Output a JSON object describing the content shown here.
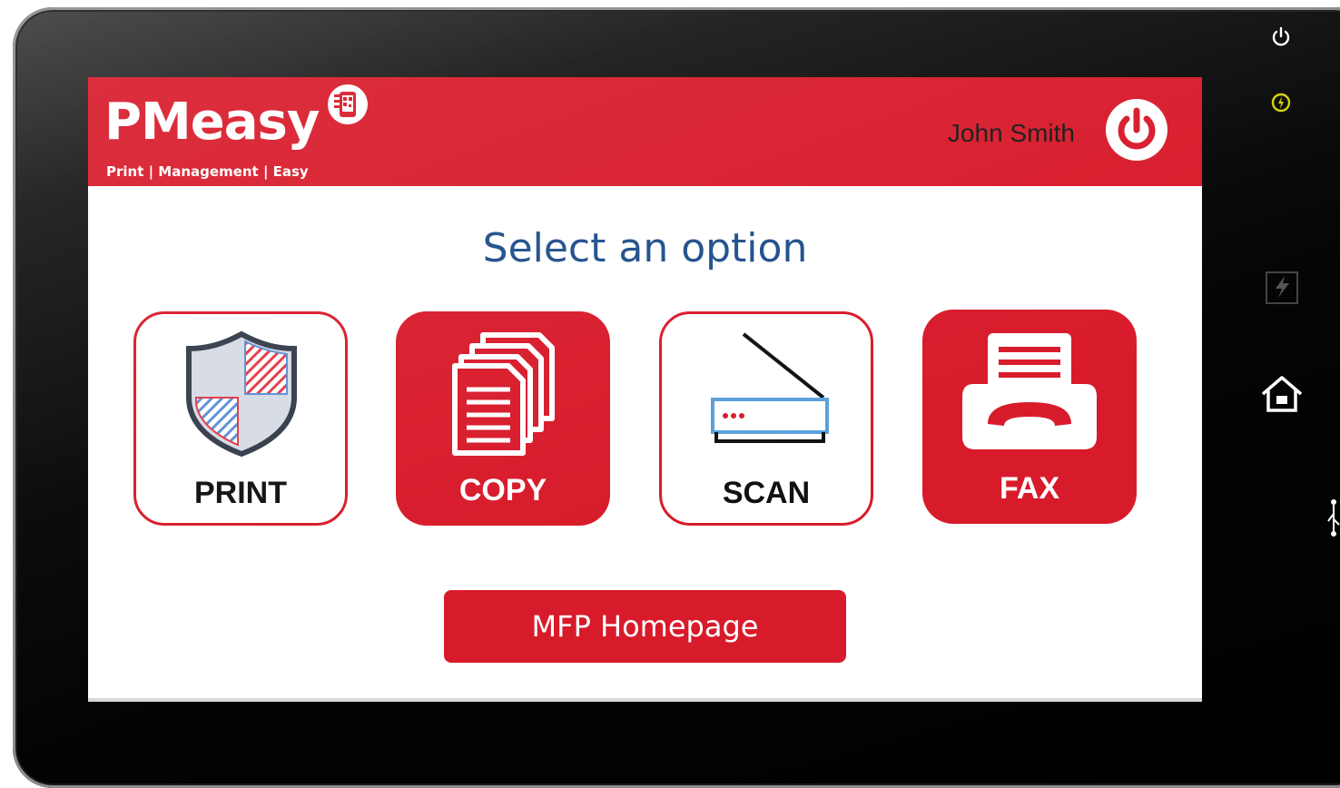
{
  "app": {
    "logo_text": "PMeasy",
    "logo_tagline": "Print | Management | Easy",
    "user_name": "John Smith"
  },
  "main": {
    "title": "Select an option",
    "options": [
      {
        "label": "PRINT",
        "icon": "shield-icon",
        "style": "outline"
      },
      {
        "label": "COPY",
        "icon": "documents-icon",
        "style": "filled"
      },
      {
        "label": "SCAN",
        "icon": "scanner-icon",
        "style": "outline"
      },
      {
        "label": "FAX",
        "icon": "fax-icon",
        "style": "filled"
      }
    ],
    "homepage_button": "MFP Homepage"
  },
  "device_buttons": [
    "power-icon",
    "energy-saver-icon",
    "sleep-icon",
    "fiery-icon",
    "home-icon",
    "usb-icon"
  ],
  "colors": {
    "brand_red": "#d81b2b",
    "title_blue": "#1f4e8a",
    "led_yellow": "#d4d400"
  }
}
